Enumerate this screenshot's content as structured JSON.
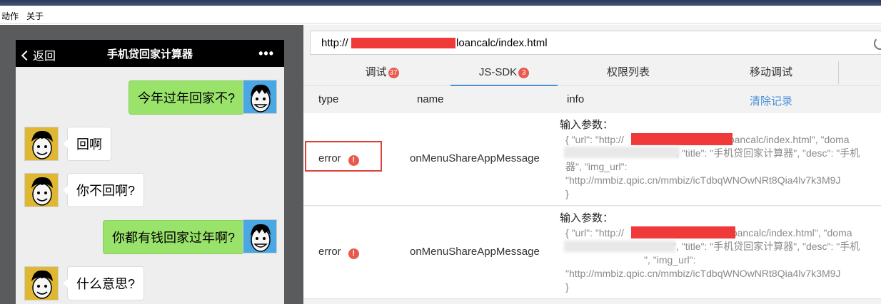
{
  "menu": {
    "action": "动作",
    "about": "关于"
  },
  "phone": {
    "back_label": "返回",
    "title": "手机贷回家计算器",
    "more": "•••",
    "messages": [
      {
        "side": "right",
        "text": "今年过年回家不?",
        "avatar": "blue"
      },
      {
        "side": "left",
        "text": "回啊",
        "avatar": "yellow"
      },
      {
        "side": "left",
        "text": "你不回啊?",
        "avatar": "yellow"
      },
      {
        "side": "right",
        "text": "你都有钱回家过年啊?",
        "avatar": "blue"
      },
      {
        "side": "left",
        "text": "什么意思?",
        "avatar": "yellow"
      }
    ]
  },
  "address": {
    "prefix": "http://",
    "suffix": "loancalc/index.html"
  },
  "tabs": [
    {
      "label": "调试",
      "badge": "37"
    },
    {
      "label": "JS-SDK",
      "badge": "3"
    },
    {
      "label": "权限列表",
      "badge": ""
    },
    {
      "label": "移动调试",
      "badge": ""
    }
  ],
  "table": {
    "headers": {
      "type": "type",
      "name": "name",
      "info": "info",
      "clear": "清除记录"
    },
    "rows": [
      {
        "type": "error",
        "name": "onMenuShareAppMessage",
        "info": [
          "输入参数：",
          "{ \"url\": \"http://",
          "/loancalc/index.html\", \"doma",
          "\", \"title\": \"手机贷回家计算器\", \"desc\": \"手机",
          "器\", \"img_url\":",
          "\"http://mmbiz.qpic.cn/mmbiz/icTdbqWNOwNRt8Qia4lv7k3M9J",
          "}"
        ]
      },
      {
        "type": "error",
        "name": "onMenuShareAppMessage",
        "info": [
          "输入参数：",
          "{ \"url\": \"http://",
          "/loancalc/index.html\", \"doma",
          "\", \"title\": \"手机贷回家计算器\", \"desc\": \"手机",
          "\", \"img_url\":",
          "\"http://mmbiz.qpic.cn/mmbiz/icTdbqWNOwNRt8Qia4lv7k3M9J",
          "}"
        ]
      }
    ]
  },
  "colors": {
    "accent": "#4a90d9",
    "badge": "#e95a4d",
    "highlight": "#d9433a",
    "bubble_green": "#9ae36b",
    "redaction": "#f03a3a"
  }
}
